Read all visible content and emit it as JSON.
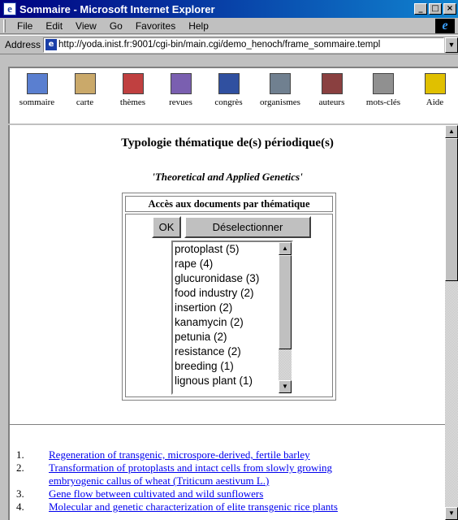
{
  "window": {
    "title": "Sommaire - Microsoft Internet Explorer",
    "min_btn": "_",
    "max_btn": "□",
    "close_btn": "×",
    "app_icon": "ie-page-icon"
  },
  "menubar": {
    "items": [
      "File",
      "Edit",
      "View",
      "Go",
      "Favorites",
      "Help"
    ]
  },
  "address": {
    "label": "Address",
    "url": "http://yoda.inist.fr:9001/cgi-bin/main.cgi/demo_henoch/frame_sommaire.templ"
  },
  "toolbar": {
    "items": [
      {
        "label": "sommaire",
        "icon": "sommaire-icon",
        "color": "#5a7fd0"
      },
      {
        "label": "carte",
        "icon": "map-icon",
        "color": "#caa96a"
      },
      {
        "label": "thèmes",
        "icon": "themes-icon",
        "color": "#c04040"
      },
      {
        "label": "revues",
        "icon": "journals-icon",
        "color": "#7a5fb0"
      },
      {
        "label": "congrès",
        "icon": "congress-icon",
        "color": "#3050a0"
      },
      {
        "label": "organismes",
        "icon": "organisations-icon",
        "color": "#708090"
      },
      {
        "label": "auteurs",
        "icon": "authors-icon",
        "color": "#8a4040"
      },
      {
        "label": "mots-clés",
        "icon": "keywords-icon",
        "color": "#909090"
      },
      {
        "label": "Aide",
        "icon": "help-icon",
        "color": "#e0c000"
      }
    ]
  },
  "main": {
    "heading": "Typologie thématique de(s) périodique(s)",
    "journal": "'Theoretical and Applied Genetics'",
    "access_header": "Accès aux documents par thématique",
    "ok_label": "OK",
    "deselect_label": "Déselectionner",
    "options": [
      "protoplast (5)",
      "rape (4)",
      "glucuronidase (3)",
      "food industry (2)",
      "insertion (2)",
      "kanamycin (2)",
      "petunia (2)",
      "resistance (2)",
      "breeding (1)",
      "lignous plant (1)"
    ],
    "results": [
      {
        "num": "1.",
        "lines": [
          "Regeneration of transgenic, microspore-derived, fertile barley"
        ]
      },
      {
        "num": "2.",
        "lines": [
          "Transformation of protoplasts and intact cells from slowly growing",
          "embryogenic callus of wheat (Triticum aestivum L.)"
        ]
      },
      {
        "num": "3.",
        "lines": [
          "Gene flow between cultivated and wild sunflowers"
        ]
      },
      {
        "num": "4.",
        "lines": [
          "Molecular and genetic characterization of elite transgenic rice plants"
        ]
      }
    ]
  }
}
